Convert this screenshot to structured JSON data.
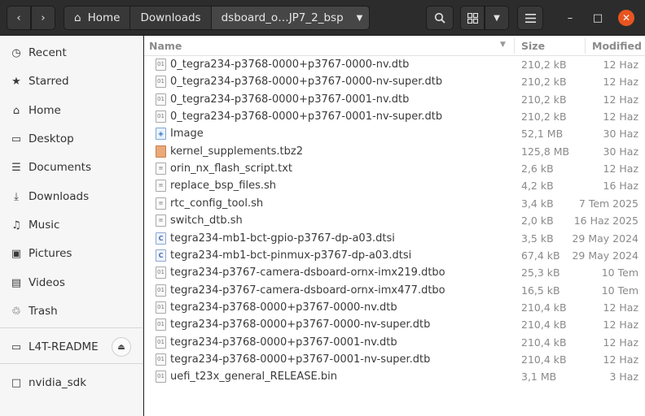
{
  "toolbar": {
    "back_icon": "chevron-left-icon",
    "forward_icon": "chevron-right-icon",
    "breadcrumbs": [
      "Home",
      "Downloads",
      "dsboard_o…JP7_2_bsp"
    ],
    "search_icon": "search-icon",
    "view_icon": "grid-view-icon",
    "menu_icon": "hamburger-icon"
  },
  "window_controls": {
    "minimize": "–",
    "maximize": "□",
    "close": "✕"
  },
  "sidebar": {
    "items": [
      {
        "label": "Recent",
        "icon": "clock-icon"
      },
      {
        "label": "Starred",
        "icon": "star-icon"
      },
      {
        "label": "Home",
        "icon": "home-icon"
      },
      {
        "label": "Desktop",
        "icon": "desktop-icon"
      },
      {
        "label": "Documents",
        "icon": "document-icon"
      },
      {
        "label": "Downloads",
        "icon": "download-icon"
      },
      {
        "label": "Music",
        "icon": "music-icon"
      },
      {
        "label": "Pictures",
        "icon": "pictures-icon"
      },
      {
        "label": "Videos",
        "icon": "video-icon"
      },
      {
        "label": "Trash",
        "icon": "trash-icon"
      }
    ],
    "devices": [
      {
        "label": "L4T-README",
        "icon": "drive-icon",
        "eject_icon": "eject-icon"
      }
    ],
    "bookmarks": [
      {
        "label": "nvidia_sdk",
        "icon": "folder-icon"
      }
    ]
  },
  "columns": {
    "name": "Name",
    "size": "Size",
    "modified": "Modified"
  },
  "files": [
    {
      "name": "0_tegra234-p3768-0000+p3767-0000-nv.dtb",
      "size": "210,2 kB",
      "modified": "12 Haz",
      "type": "generic"
    },
    {
      "name": "0_tegra234-p3768-0000+p3767-0000-nv-super.dtb",
      "size": "210,2 kB",
      "modified": "12 Haz",
      "type": "generic"
    },
    {
      "name": "0_tegra234-p3768-0000+p3767-0001-nv.dtb",
      "size": "210,2 kB",
      "modified": "12 Haz",
      "type": "generic"
    },
    {
      "name": "0_tegra234-p3768-0000+p3767-0001-nv-super.dtb",
      "size": "210,2 kB",
      "modified": "12 Haz",
      "type": "generic"
    },
    {
      "name": "Image",
      "size": "52,1 MB",
      "modified": "30 Haz",
      "type": "image"
    },
    {
      "name": "kernel_supplements.tbz2",
      "size": "125,8 MB",
      "modified": "30 Haz",
      "type": "archive"
    },
    {
      "name": "orin_nx_flash_script.txt",
      "size": "2,6 kB",
      "modified": "12 Haz",
      "type": "text"
    },
    {
      "name": "replace_bsp_files.sh",
      "size": "4,2 kB",
      "modified": "16 Haz",
      "type": "script"
    },
    {
      "name": "rtc_config_tool.sh",
      "size": "3,4 kB",
      "modified": "7 Tem 2025",
      "type": "script"
    },
    {
      "name": "switch_dtb.sh",
      "size": "2,0 kB",
      "modified": "16 Haz 2025",
      "type": "script"
    },
    {
      "name": "tegra234-mb1-bct-gpio-p3767-dp-a03.dtsi",
      "size": "3,5 kB",
      "modified": "29 May 2024",
      "type": "c"
    },
    {
      "name": "tegra234-mb1-bct-pinmux-p3767-dp-a03.dtsi",
      "size": "67,4 kB",
      "modified": "29 May 2024",
      "type": "c"
    },
    {
      "name": "tegra234-p3767-camera-dsboard-ornx-imx219.dtbo",
      "size": "25,3 kB",
      "modified": "10 Tem",
      "type": "generic"
    },
    {
      "name": "tegra234-p3767-camera-dsboard-ornx-imx477.dtbo",
      "size": "16,5 kB",
      "modified": "10 Tem",
      "type": "generic"
    },
    {
      "name": "tegra234-p3768-0000+p3767-0000-nv.dtb",
      "size": "210,4 kB",
      "modified": "12 Haz",
      "type": "generic"
    },
    {
      "name": "tegra234-p3768-0000+p3767-0000-nv-super.dtb",
      "size": "210,4 kB",
      "modified": "12 Haz",
      "type": "generic"
    },
    {
      "name": "tegra234-p3768-0000+p3767-0001-nv.dtb",
      "size": "210,4 kB",
      "modified": "12 Haz",
      "type": "generic"
    },
    {
      "name": "tegra234-p3768-0000+p3767-0001-nv-super.dtb",
      "size": "210,4 kB",
      "modified": "12 Haz",
      "type": "generic"
    },
    {
      "name": "uefi_t23x_general_RELEASE.bin",
      "size": "3,1 MB",
      "modified": "3 Haz",
      "type": "generic"
    }
  ]
}
